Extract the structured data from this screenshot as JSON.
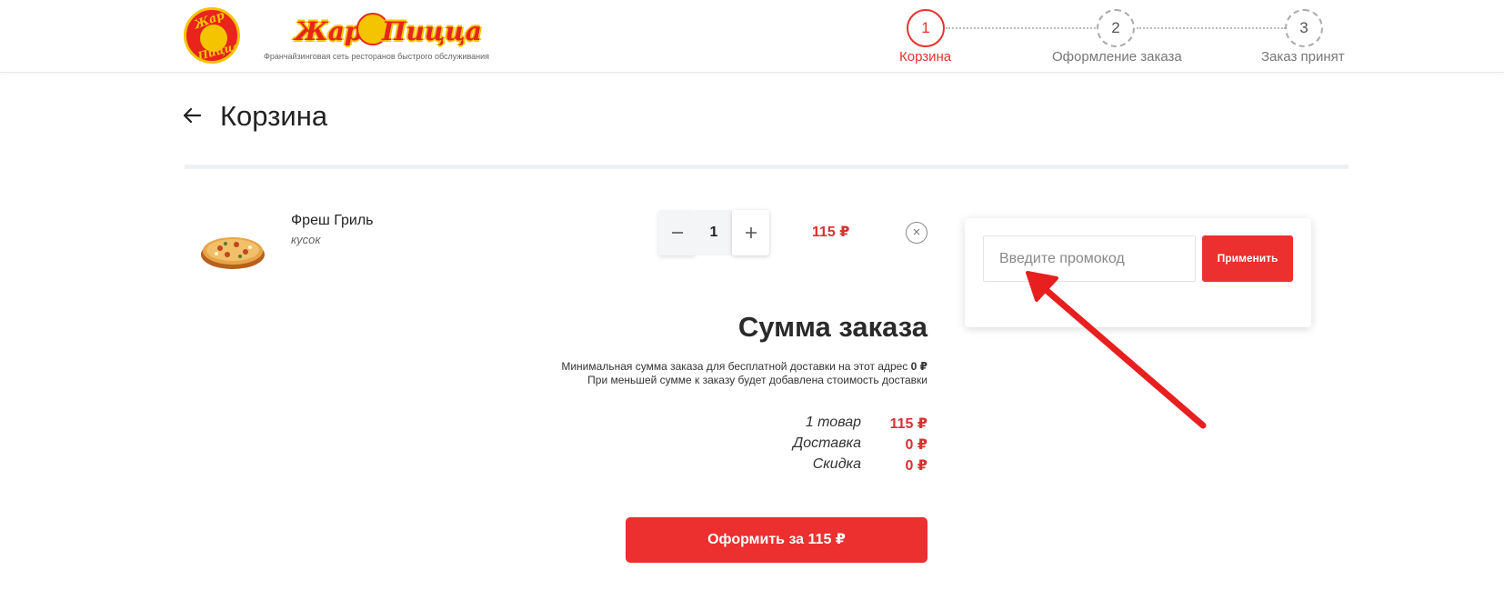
{
  "header": {
    "logo_text_top": "Жар",
    "logo_text_bottom": "Пицца",
    "logo_word_left": "Жар",
    "logo_word_right": "Пицца",
    "tagline": "Франчайзинговая сеть ресторанов быстрого обслуживания",
    "steps": [
      {
        "number": "1",
        "label": "Корзина",
        "active": true
      },
      {
        "number": "2",
        "label": "Оформление заказа",
        "active": false
      },
      {
        "number": "3",
        "label": "Заказ принят",
        "active": false
      }
    ]
  },
  "page": {
    "title": "Корзина"
  },
  "cart": {
    "items": [
      {
        "name": "Фреш Гриль",
        "variant": "кусок",
        "quantity": "1",
        "price": "115 ₽"
      }
    ]
  },
  "summary": {
    "title": "Сумма заказа",
    "note_line1": "Минимальная сумма заказа для бесплатной доставки на этот адрес",
    "note_line1_value": "0 ₽",
    "note_line2": "При меньшей сумме к заказу будет добавлена стоимость доставки",
    "rows": [
      {
        "label": "1 товар",
        "value": "115 ₽"
      },
      {
        "label": "Доставка",
        "value": "0 ₽"
      },
      {
        "label": "Скидка",
        "value": "0 ₽"
      }
    ],
    "checkout_label": "Оформить за 115 ₽"
  },
  "promo": {
    "placeholder": "Введите промокод",
    "apply_label": "Применить"
  },
  "colors": {
    "accent": "#ec2f2f",
    "price": "#d83232",
    "brand_yellow": "#f5c400"
  }
}
